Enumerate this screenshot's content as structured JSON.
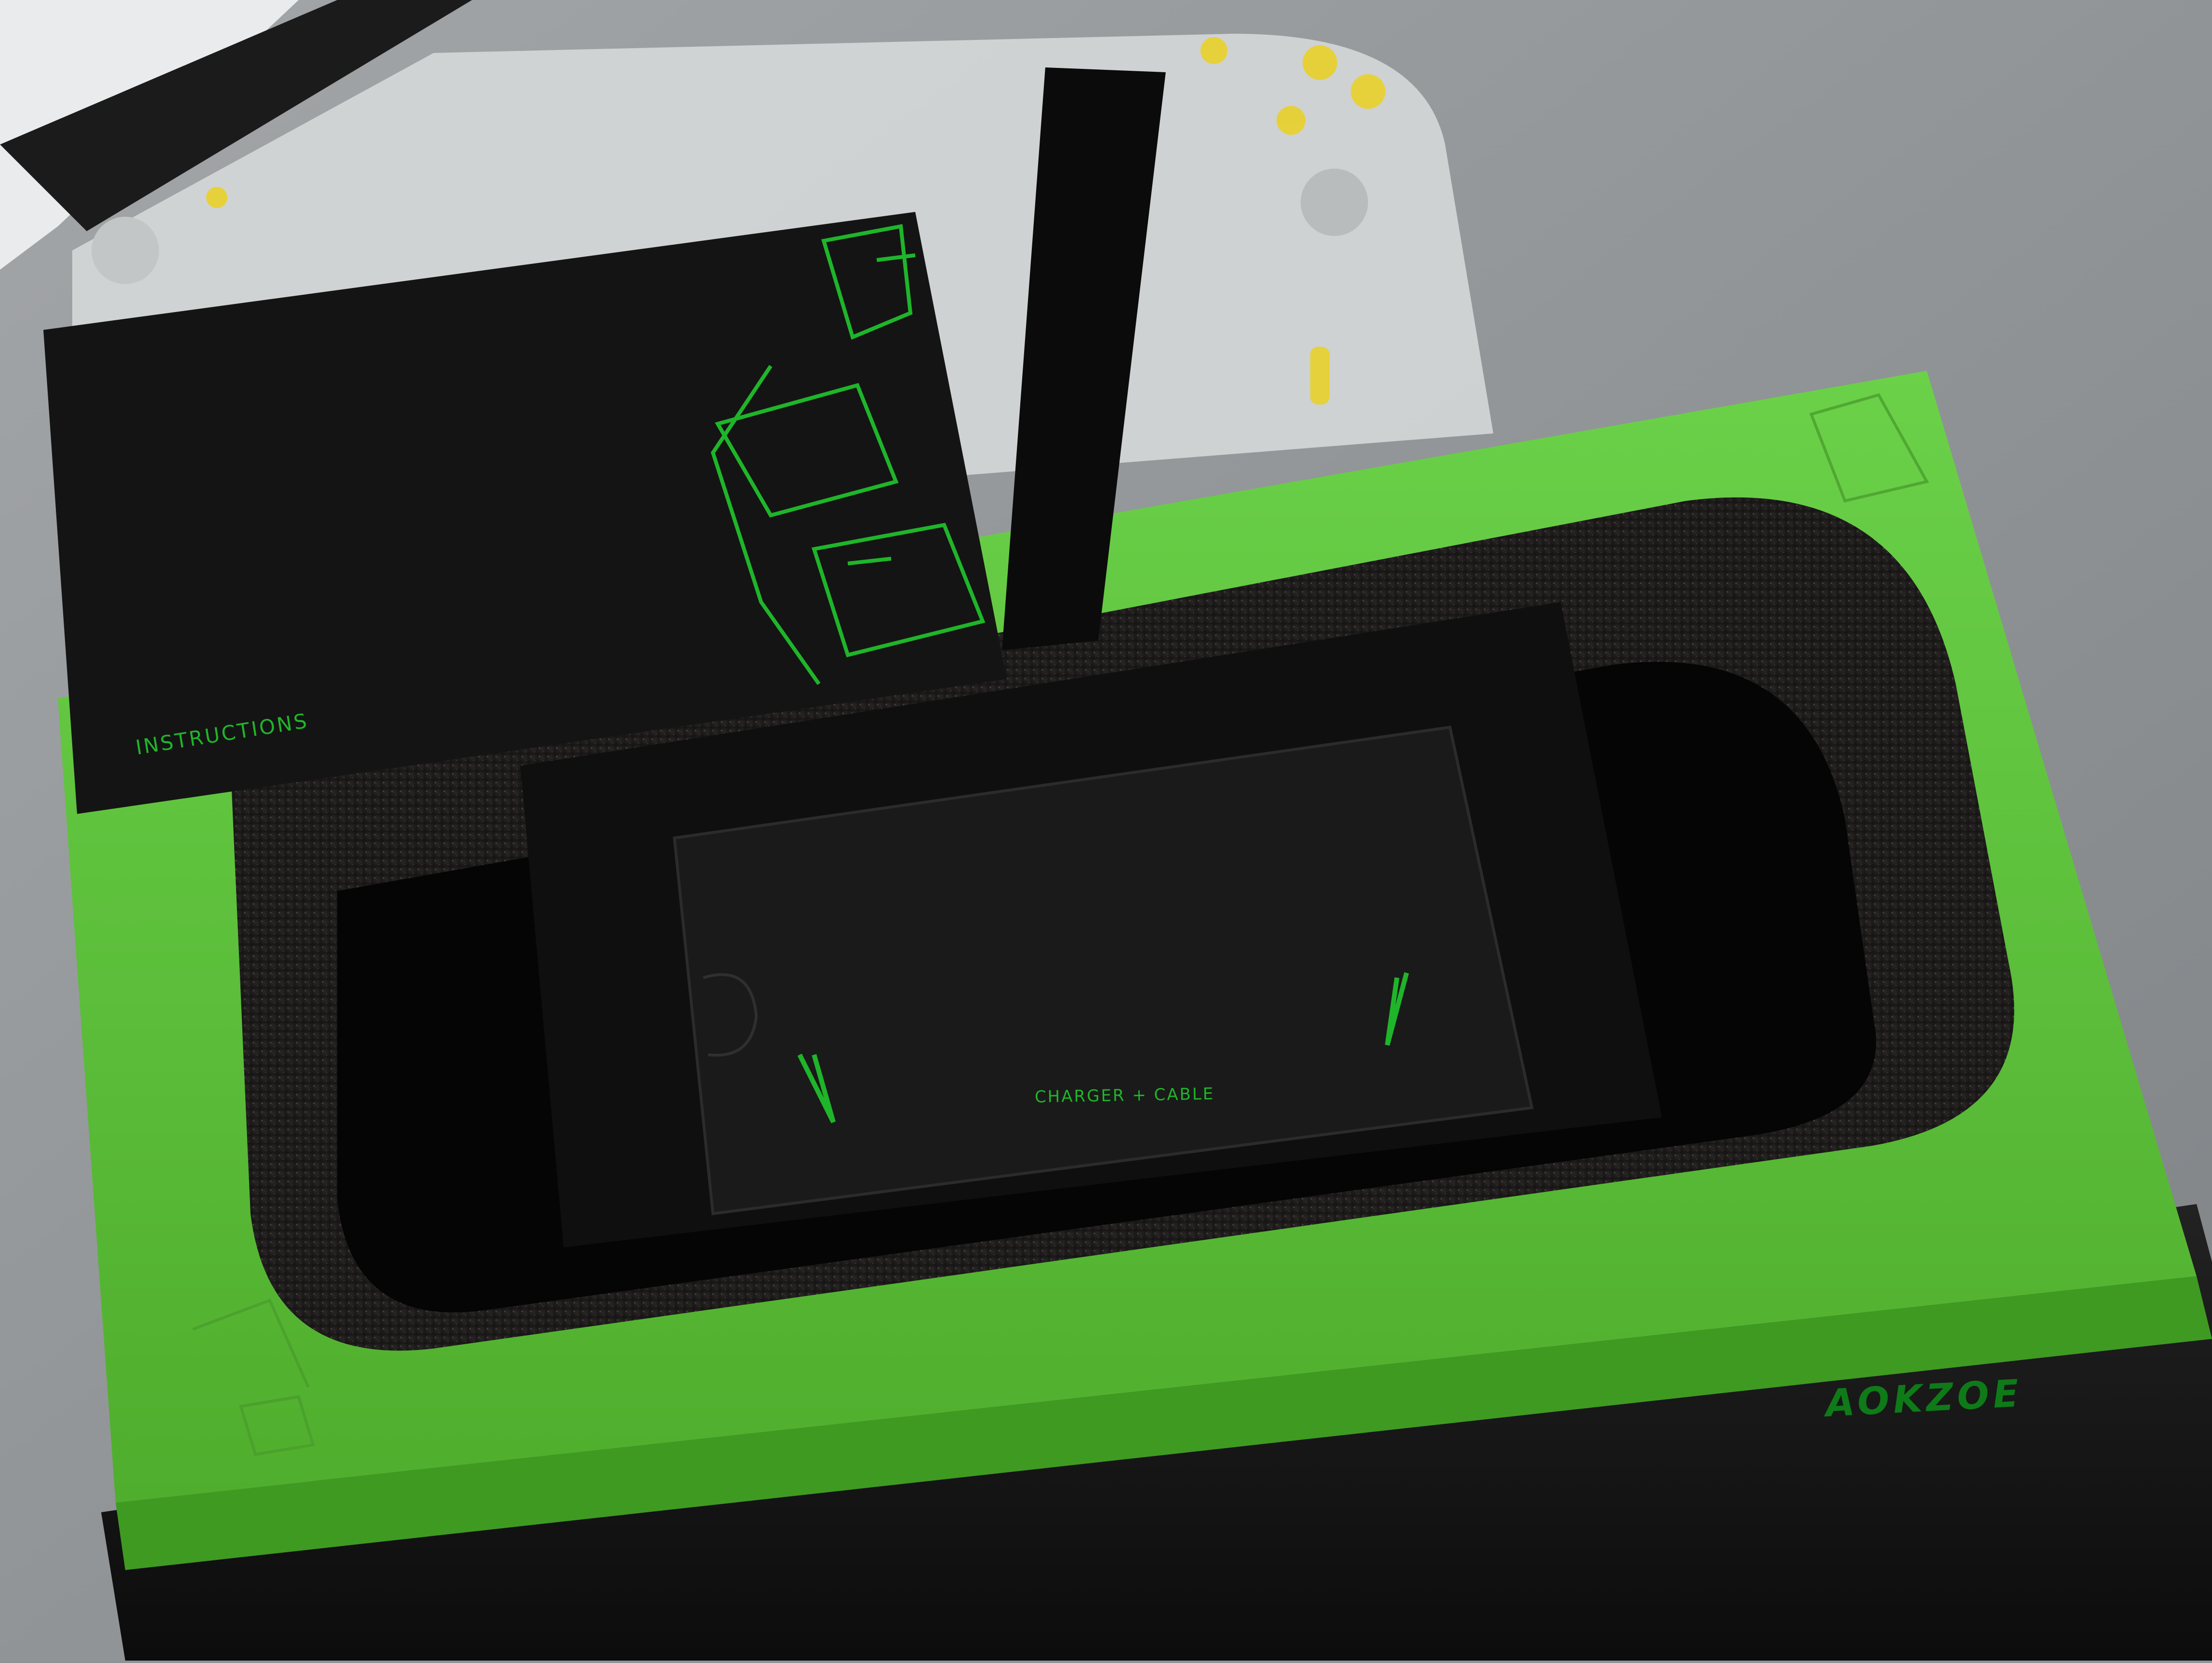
{
  "scene": {
    "instructions_text": "INSTRUCTIONS",
    "charger_text": "CHARGER + CABLE",
    "brand_text": "AOKZOE"
  },
  "colors": {
    "background": "#8f9396",
    "box_green": "#5ec43c",
    "box_black": "#141414",
    "foam": "#1c1a1a",
    "foil_green": "#1fb52a",
    "button_yellow": "#e8d02a"
  }
}
